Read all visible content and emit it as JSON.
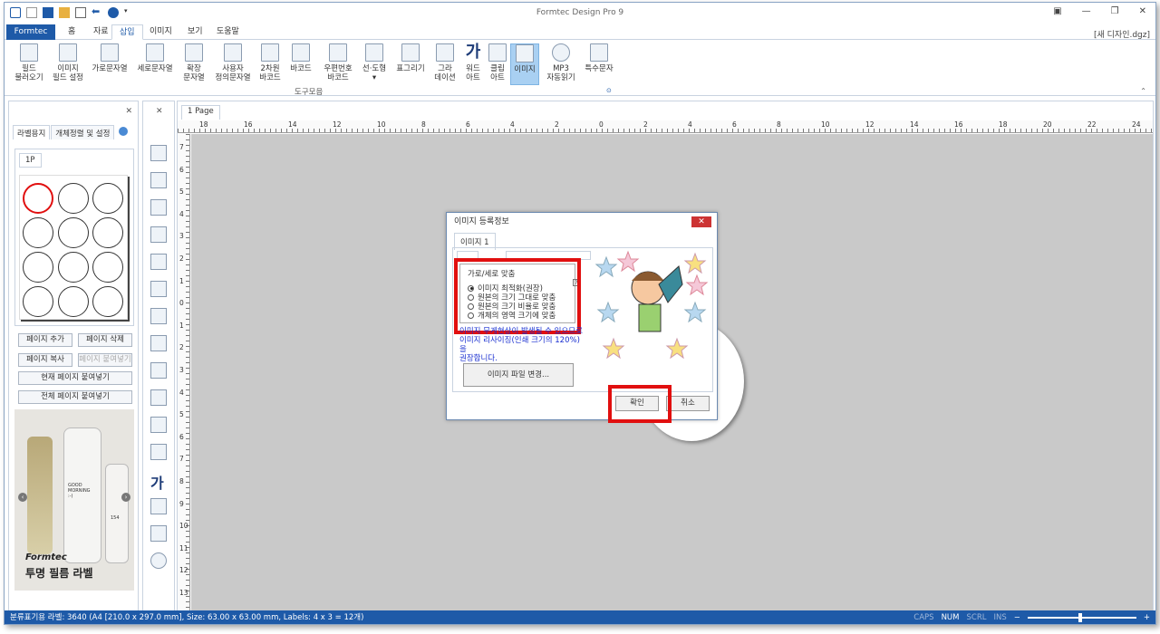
{
  "app": {
    "title": "Formtec Design Pro 9",
    "document": "[새 디자인.dgz]"
  },
  "tabs": [
    "Formtec",
    "홈",
    "자료",
    "삽입",
    "이미지",
    "보기",
    "도움말"
  ],
  "active_tab": "삽입",
  "ribbon": {
    "buttons": [
      {
        "label1": "필드",
        "label2": "불러오기"
      },
      {
        "label1": "이미지",
        "label2": "필드 설정"
      },
      {
        "label1": "가로문자열",
        "label2": ""
      },
      {
        "label1": "세로문자열",
        "label2": ""
      },
      {
        "label1": "확장",
        "label2": "문자열"
      },
      {
        "label1": "사용자",
        "label2": "정의문자열"
      },
      {
        "label1": "2차원",
        "label2": "바코드"
      },
      {
        "label1": "바코드",
        "label2": ""
      },
      {
        "label1": "우편번호",
        "label2": "바코드"
      },
      {
        "label1": "선·도형",
        "label2": "▾"
      },
      {
        "label1": "표그리기",
        "label2": ""
      },
      {
        "label1": "그라",
        "label2": "데이션"
      },
      {
        "label1": "워드",
        "label2": "아트"
      },
      {
        "label1": "클립",
        "label2": "아트"
      },
      {
        "label1": "이미지",
        "label2": ""
      },
      {
        "label1": "MP3",
        "label2": "자동읽기"
      },
      {
        "label1": "특수문자",
        "label2": ""
      }
    ],
    "group_label": "도구모음"
  },
  "left_panel": {
    "tabs": [
      "라벨용지",
      "개체정렬 및 설정"
    ],
    "page_label": "1P",
    "buttons": {
      "add_page": "페이지 추가",
      "delete_page": "페이지 삭제",
      "copy_page": "페이지 복사",
      "paste_page": "페이지 붙여넣기",
      "paste_current": "현재 페이지 붙여넣기",
      "paste_all": "전체 페이지 붙여넣기"
    },
    "ad": {
      "brand": "Formtec",
      "title": "투명 필름 라벨",
      "bottle_text1": "GOOD",
      "bottle_text2": "MORNING",
      "bottle_text3": ":-)",
      "bottle_num": "154"
    }
  },
  "canvas": {
    "doc_tab": "1 Page",
    "hruler_labels": [
      "18",
      "16",
      "14",
      "12",
      "10",
      "8",
      "6",
      "4",
      "2",
      "0",
      "2",
      "4",
      "6",
      "8",
      "10",
      "12",
      "14",
      "16",
      "18",
      "20",
      "22",
      "24"
    ],
    "vruler_labels": [
      "7",
      "6",
      "5",
      "4",
      "3",
      "2",
      "1",
      "0",
      "1",
      "2",
      "3",
      "4",
      "5",
      "6",
      "7",
      "8",
      "9",
      "10",
      "11",
      "12",
      "13"
    ]
  },
  "dialog": {
    "title": "이미지 등록정보",
    "close": "✕",
    "tab": "이미지 1",
    "fit_legend": "가로/세로 맞춤",
    "help": "?",
    "options": [
      "이미지 최적화(권장)",
      "원본의 크기 그대로 맞춤",
      "원본의 크기 비율로 맞춤",
      "개체의 영역 크기에 맞춤"
    ],
    "selected_option": 0,
    "note_line1": "이미지 무게현상이 발생될 수 있으므로",
    "note_line2": "이미지 리사이징(인쇄 크기의 120%)을",
    "note_line3": "권장합니다.",
    "change_file": "이미지 파일 변경...",
    "ok": "확인",
    "cancel": "취소"
  },
  "status": {
    "text": "분류표기용 라벨: 3640 (A4 [210.0 x 297.0 mm], Size: 63.00 x 63.00 mm, Labels: 4 x 3 = 12개)",
    "caps": "CAPS",
    "num": "NUM",
    "scrl": "SCRL",
    "ins": "INS",
    "minus": "−",
    "plus": "+"
  },
  "colors": {
    "accent": "#1e5aa8",
    "highlight": "#e10f0f",
    "canvas": "#c9c9c9"
  }
}
